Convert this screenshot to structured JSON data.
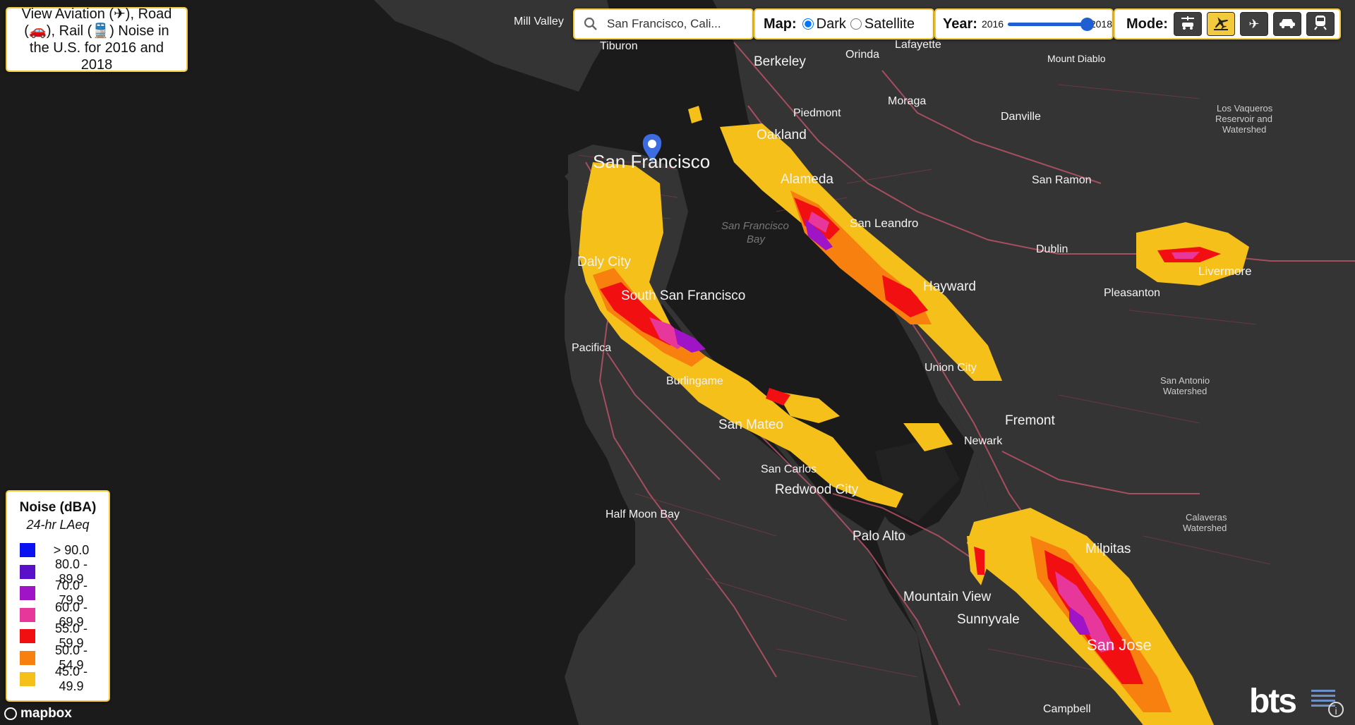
{
  "title": "View Aviation (✈), Road (🚗), Rail (🚆) Noise in the U.S. for 2016 and 2018",
  "search": {
    "value": "San Francisco, Cali..."
  },
  "map_style": {
    "label": "Map:",
    "options": [
      "Dark",
      "Satellite"
    ],
    "selected": "Dark"
  },
  "year": {
    "label": "Year:",
    "min": "2016",
    "max": "2018",
    "selected_fraction": 1.0
  },
  "mode": {
    "label": "Mode:",
    "buttons": [
      {
        "icon": "all-modes-icon",
        "active": false
      },
      {
        "icon": "aviation-highlight-icon",
        "active": true
      },
      {
        "icon": "aviation-icon",
        "active": false
      },
      {
        "icon": "road-icon",
        "active": false
      },
      {
        "icon": "rail-icon",
        "active": false
      }
    ]
  },
  "legend": {
    "title": "Noise (dBA)",
    "subtitle": "24-hr LAeq",
    "items": [
      {
        "label": "> 90.0",
        "color": "#0a12f2"
      },
      {
        "label": "80.0 - 89.9",
        "color": "#5a10c8"
      },
      {
        "label": "70.0 - 79.9",
        "color": "#a014c8"
      },
      {
        "label": "60.0 - 69.9",
        "color": "#e8379a"
      },
      {
        "label": "55.0 - 59.9",
        "color": "#f20f12"
      },
      {
        "label": "50.0 - 54.9",
        "color": "#f7800f"
      },
      {
        "label": "45.0 - 49.9",
        "color": "#f5c01a"
      }
    ]
  },
  "places": {
    "major": [
      "San Francisco",
      "Oakland",
      "Berkeley",
      "Alameda",
      "Daly City",
      "South San Francisco",
      "Hayward",
      "San Mateo",
      "Redwood City",
      "Palo Alto",
      "Mountain View",
      "Sunnyvale",
      "San Jose",
      "Milpitas",
      "Fremont",
      "Livermore",
      "San Leandro"
    ],
    "minor": [
      "Mill Valley",
      "Tiburon",
      "Lafayette",
      "Orinda",
      "Piedmont",
      "Moraga",
      "Danville",
      "San Ramon",
      "Dublin",
      "Pleasanton",
      "Union City",
      "Newark",
      "Pacifica",
      "Burlingame",
      "San Carlos",
      "Half Moon Bay",
      "Campbell"
    ],
    "water": "San Francisco Bay",
    "parks": [
      "Mount Diablo",
      "Los Vaqueros Reservoir and Watershed",
      "San Antonio Watershed",
      "Calaveras Watershed"
    ]
  },
  "attribution": {
    "mapbox": "mapbox",
    "bts": "bts",
    "info": "i"
  }
}
